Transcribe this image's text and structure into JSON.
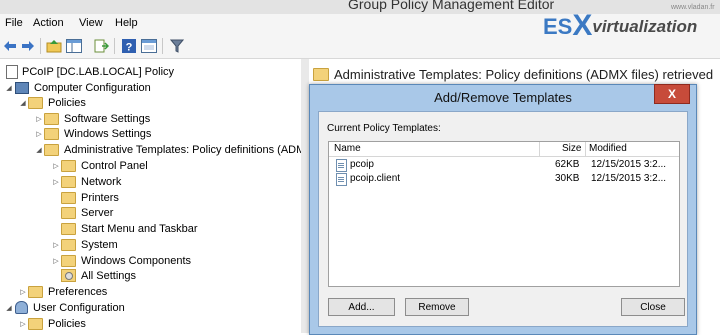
{
  "window": {
    "title": "Group Policy Management Editor"
  },
  "menu": [
    "File",
    "Action",
    "View",
    "Help"
  ],
  "toolbar": {
    "icons": [
      "back-arrow-icon",
      "forward-arrow-icon",
      "up-folder-icon",
      "show-hide-tree-icon",
      "export-list-icon",
      "help-icon",
      "properties-icon",
      "filter-icon"
    ]
  },
  "tree": {
    "root": "PCoIP [DC.LAB.LOCAL] Policy",
    "computer_config": "Computer Configuration",
    "policies": "Policies",
    "software_settings": "Software Settings",
    "windows_settings": "Windows Settings",
    "admin_templates": "Administrative Templates: Policy definitions (ADMX",
    "control_panel": "Control Panel",
    "network": "Network",
    "printers": "Printers",
    "server": "Server",
    "start_menu": "Start Menu and Taskbar",
    "system": "System",
    "windows_components": "Windows Components",
    "all_settings": "All Settings",
    "preferences": "Preferences",
    "user_config": "User Configuration",
    "user_policies": "Policies"
  },
  "right_pane": {
    "header": "Administrative Templates: Policy definitions (ADMX files) retrieved"
  },
  "watermark": {
    "es": "ES",
    "x": "X",
    "rest": "virtualization",
    "url": "www.vladan.fr"
  },
  "dialog": {
    "title": "Add/Remove Templates",
    "close": "X",
    "current_label": "Current Policy Templates:",
    "columns": {
      "name": "Name",
      "size": "Size",
      "modified": "Modified"
    },
    "rows": [
      {
        "name": "pcoip",
        "size": "62KB",
        "modified": "12/15/2015 3:2..."
      },
      {
        "name": "pcoip.client",
        "size": "30KB",
        "modified": "12/15/2015 3:2..."
      }
    ],
    "add_button": "Add...",
    "remove_button": "Remove",
    "close_button": "Close"
  }
}
